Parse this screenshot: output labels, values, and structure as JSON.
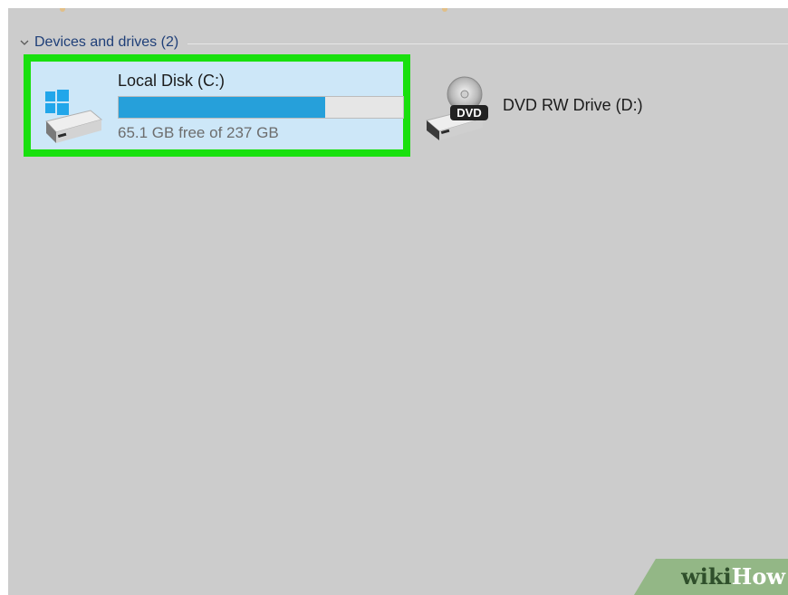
{
  "explorer": {
    "group": {
      "title": "Devices and drives (2)",
      "expanded": true,
      "icon": "chevron-down-icon"
    },
    "drives": [
      {
        "name": "Local Disk (C:)",
        "free_text": "65.1 GB free of 237 GB",
        "usage_fraction": 0.725,
        "icon": "windows-hard-drive-icon",
        "selected": true,
        "highlight_color": "#19e00e"
      },
      {
        "name": "DVD RW Drive (D:)",
        "icon": "dvd-drive-icon",
        "icon_label": "DVD",
        "selected": false
      }
    ]
  },
  "colors": {
    "background": "#cccccc",
    "selection": "#cde7f8",
    "bar_fill": "#26a0da",
    "group_title": "#1f3f78"
  },
  "watermark": {
    "part1": "wiki",
    "part2": "How"
  }
}
